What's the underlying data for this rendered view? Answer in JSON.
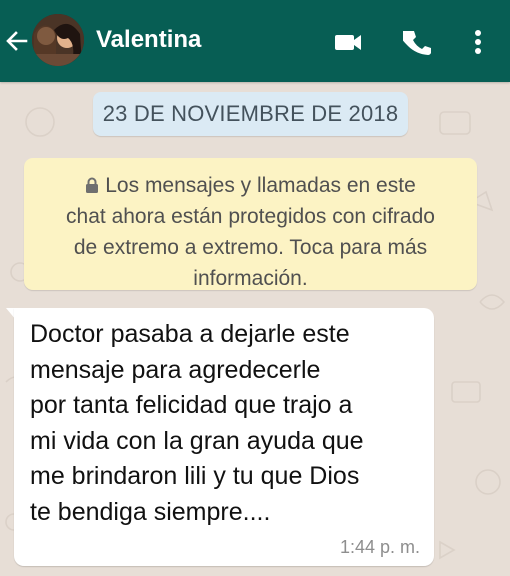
{
  "header": {
    "contact_name": "Valentina",
    "icons": [
      "back-arrow-icon",
      "video-call-icon",
      "phone-call-icon",
      "more-options-icon"
    ]
  },
  "conversation": {
    "date_chip": "23 DE NOVIEMBRE DE 2018",
    "encryption_notice": [
      "Los mensajes y llamadas en este",
      "chat ahora están protegidos con cifrado",
      "de extremo a extremo. Toca para más",
      "información."
    ],
    "messages": [
      {
        "lines": [
          "Doctor pasaba a dejarle este",
          "mensaje para agredecerle",
          "por tanta felicidad que trajo a",
          "mi vida con la gran ayuda que",
          "me brindaron lili y tu que Dios",
          "te bendiga siempre...."
        ],
        "time": "1:44 p. m."
      }
    ]
  },
  "colors": {
    "header": "#075e54",
    "wallpaper": "#e7ded6",
    "date_chip": "#dbeaf4",
    "notice": "#fcf3c4",
    "incoming_bubble": "#ffffff"
  }
}
